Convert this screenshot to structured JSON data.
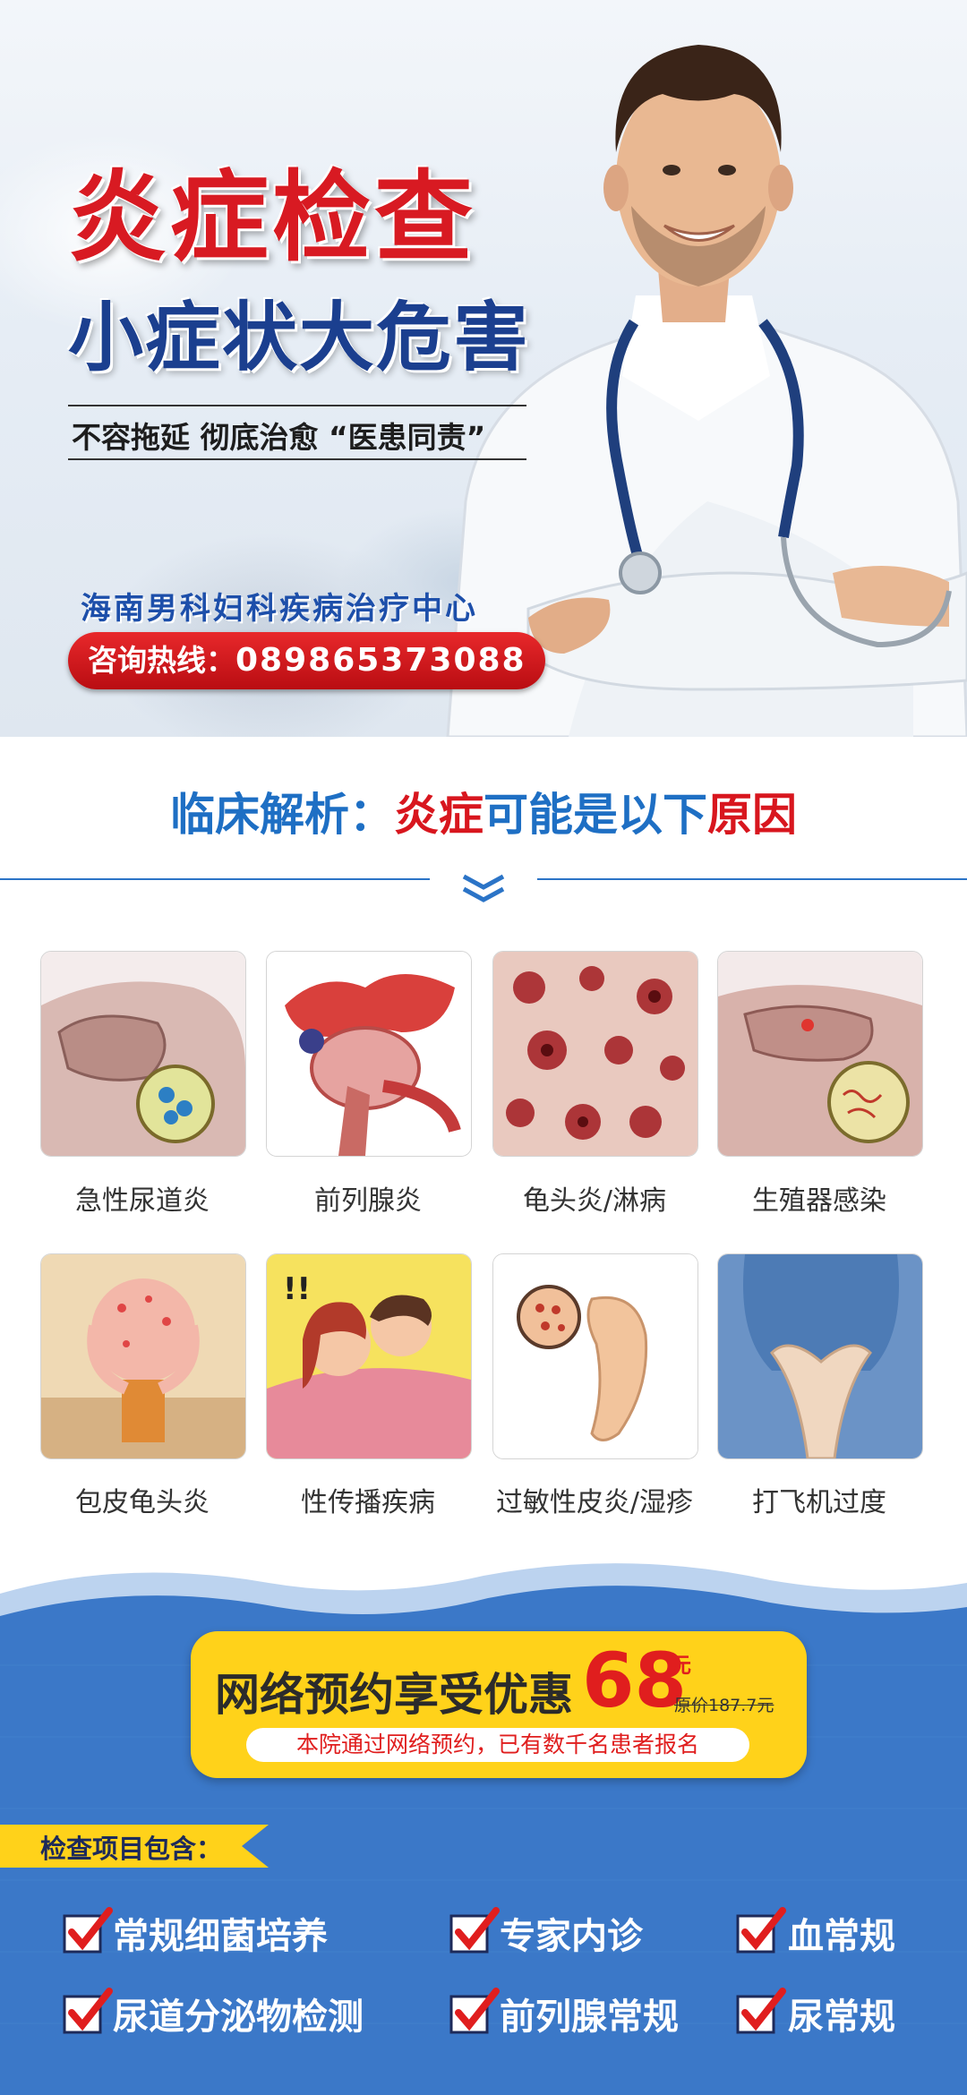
{
  "hero": {
    "title": "炎症检查",
    "subtitle": "小症状大危害",
    "slogan": "不容拖延  彻底治愈 “医患同责”",
    "center_name": "海南男科妇科疾病治疗中心",
    "hotline_label": "咨询热线：",
    "hotline_number": "089865373088"
  },
  "analysis": {
    "prefix": "临床解析：",
    "highlight1": "炎症",
    "middle": "可能是以下",
    "highlight2": "原因"
  },
  "conditions": [
    {
      "label": "急性尿道炎",
      "icon": "urethritis-illustration"
    },
    {
      "label": "前列腺炎",
      "icon": "prostate-illustration"
    },
    {
      "label": "龟头炎/淋病",
      "icon": "microscope-cells-illustration"
    },
    {
      "label": "生殖器感染",
      "icon": "infection-illustration"
    },
    {
      "label": "包皮龟头炎",
      "icon": "itching-cartoon-illustration"
    },
    {
      "label": "性传播疾病",
      "icon": "couple-cartoon-illustration"
    },
    {
      "label": "过敏性皮炎/湿疹",
      "icon": "rash-illustration"
    },
    {
      "label": "打飞机过度",
      "icon": "hands-illustration"
    }
  ],
  "promo": {
    "title": "网络预约享受优惠",
    "price": "68",
    "unit": "元",
    "original": "原价187.7元",
    "subtitle": "本院通过网络预约，已有数千名患者报名"
  },
  "checklist": {
    "heading": "检查项目包含：",
    "items": [
      "常规细菌培养",
      "专家内诊",
      "血常规",
      "尿道分泌物检测",
      "前列腺常规",
      "尿常规"
    ]
  },
  "colors": {
    "brand_red": "#d8161e",
    "brand_blue": "#1e6fc4",
    "promo_yellow": "#ffd21a",
    "bottom_blue": "#3b78c8"
  }
}
